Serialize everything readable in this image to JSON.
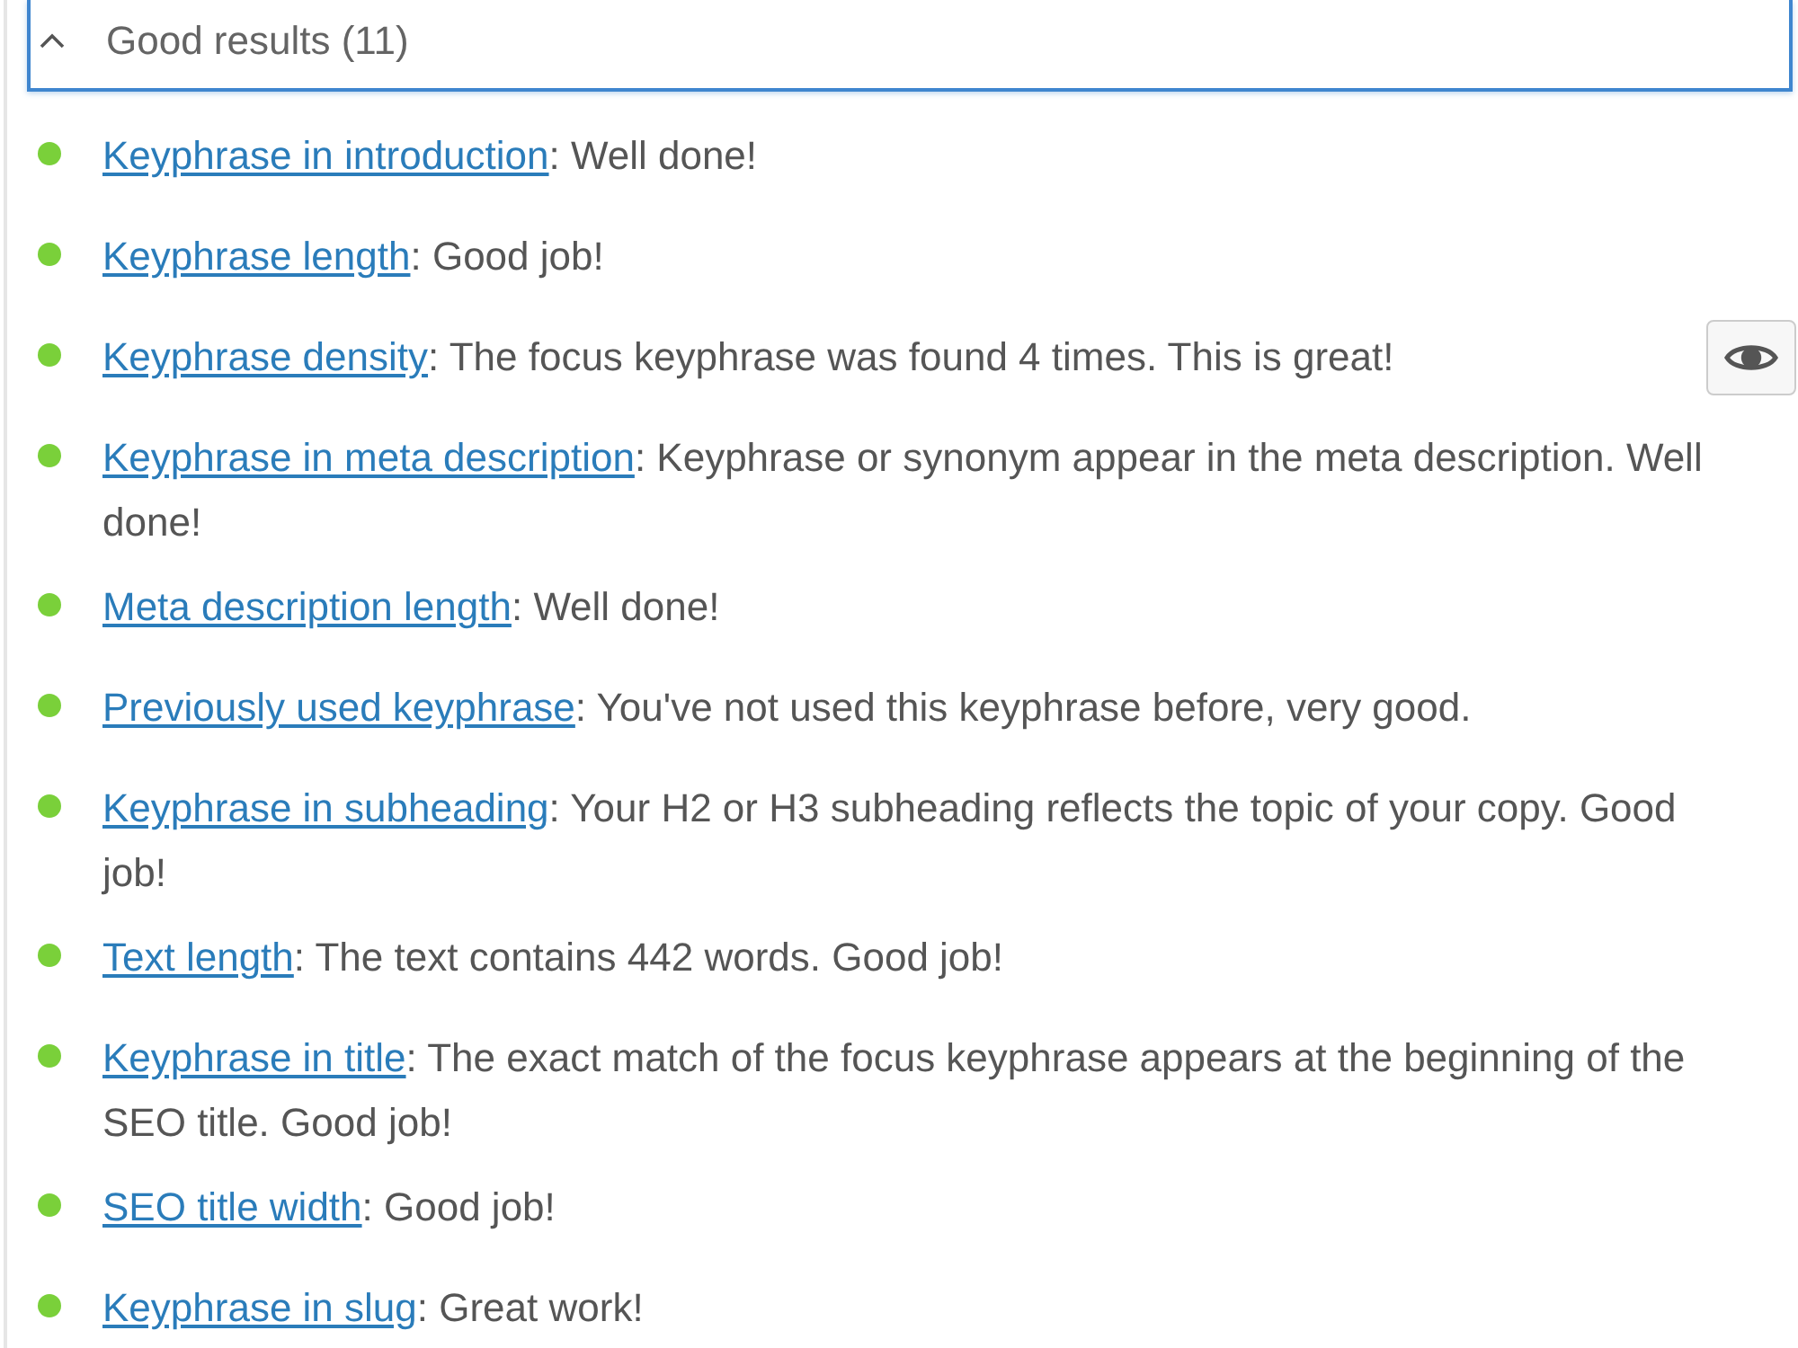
{
  "section": {
    "title": "Good results (11)",
    "expanded": true
  },
  "results": [
    {
      "link": "Keyphrase in introduction",
      "text": ": Well done!",
      "marker_button": false
    },
    {
      "link": "Keyphrase length",
      "text": ": Good job!",
      "marker_button": false
    },
    {
      "link": "Keyphrase density",
      "text": ": The focus keyphrase was found 4 times. This is great!",
      "marker_button": true
    },
    {
      "link": "Keyphrase in meta description",
      "text": ": Keyphrase or synonym appear in the meta description. Well done!",
      "marker_button": false
    },
    {
      "link": "Meta description length",
      "text": ": Well done!",
      "marker_button": false
    },
    {
      "link": "Previously used keyphrase",
      "text": ": You've not used this keyphrase before, very good.",
      "marker_button": false
    },
    {
      "link": "Keyphrase in subheading",
      "text": ": Your H2 or H3 subheading reflects the topic of your copy. Good job!",
      "marker_button": false
    },
    {
      "link": "Text length",
      "text": ": The text contains 442 words. Good job!",
      "marker_button": false
    },
    {
      "link": "Keyphrase in title",
      "text": ": The exact match of the focus keyphrase appears at the beginning of the SEO title. Good job!",
      "marker_button": false
    },
    {
      "link": "SEO title width",
      "text": ": Good job!",
      "marker_button": false
    },
    {
      "link": "Keyphrase in slug",
      "text": ": Great work!",
      "marker_button": false
    }
  ]
}
